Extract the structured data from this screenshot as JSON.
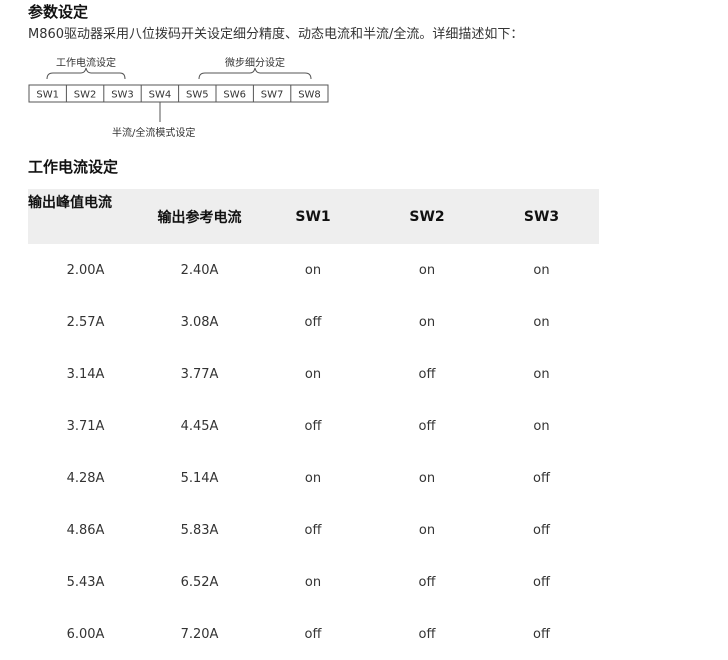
{
  "section1": {
    "title": "参数设定",
    "intro": "M860驱动器采用八位拨码开关设定细分精度、动态电流和半流/全流。详细描述如下："
  },
  "switch_diagram": {
    "group_current": "工作电流设定",
    "group_microstep": "微步细分设定",
    "half_full_label": "半流/全流模式设定",
    "switches": [
      "SW1",
      "SW2",
      "SW3",
      "SW4",
      "SW5",
      "SW6",
      "SW7",
      "SW8"
    ]
  },
  "section2": {
    "title": "工作电流设定"
  },
  "current_table": {
    "headers": {
      "peak": "输出峰值电流",
      "ref": "输出参考电流",
      "sw1": "SW1",
      "sw2": "SW2",
      "sw3": "SW3"
    },
    "rows": [
      [
        "2.00A",
        "2.40A",
        "on",
        "on",
        "on"
      ],
      [
        "2.57A",
        "3.08A",
        "off",
        "on",
        "on"
      ],
      [
        "3.14A",
        "3.77A",
        "on",
        "off",
        "on"
      ],
      [
        "3.71A",
        "4.45A",
        "off",
        "off",
        "on"
      ],
      [
        "4.28A",
        "5.14A",
        "on",
        "on",
        "off"
      ],
      [
        "4.86A",
        "5.83A",
        "off",
        "on",
        "off"
      ],
      [
        "5.43A",
        "6.52A",
        "on",
        "off",
        "off"
      ],
      [
        "6.00A",
        "7.20A",
        "off",
        "off",
        "off"
      ]
    ]
  }
}
